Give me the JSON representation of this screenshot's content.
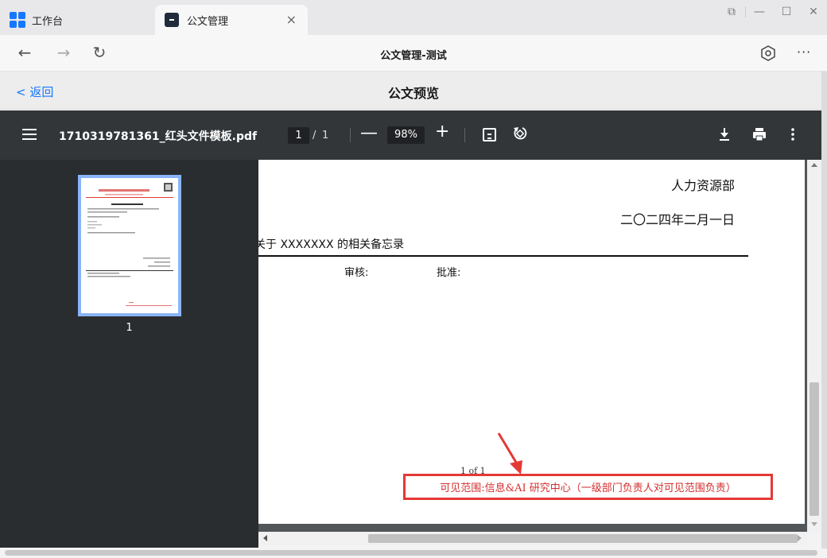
{
  "browser": {
    "tabs": [
      {
        "label": "工作台"
      },
      {
        "label": "公文管理"
      }
    ],
    "tab_close_glyph": "×",
    "window_controls": [
      "⧉",
      "—",
      "☐",
      "✕"
    ],
    "nav": {
      "back": "←",
      "forward": "→",
      "reload": "↻",
      "title": "公文管理-测试",
      "more": "···"
    }
  },
  "page_header": {
    "back_label": "< 返回",
    "title": "公文预览"
  },
  "pdf_toolbar": {
    "file_name": "1710319781361_红头文件模板.pdf",
    "current_page": "1",
    "page_separator": "/",
    "total_pages": "1",
    "zoom_minus": "—",
    "zoom": "98%",
    "zoom_plus": "+"
  },
  "sidebar": {
    "thumbnail_label": "1"
  },
  "document": {
    "department": "人力资源部",
    "date": "二〇二四年二月一日",
    "subject": "关于 XXXXXXX 的相关备忘录",
    "review_label": "审核:",
    "approve_label": "批准:",
    "page_footer": "1 of 1",
    "visible_scope_note": "可见范围:信息&AI 研究中心（一级部门负责人对可见范围负责）"
  },
  "colors": {
    "accent": "#1677ff",
    "toolbar_bg": "#323639",
    "sidebar_bg": "#2a2d30",
    "annotation_red": "#e53935",
    "thumb_border": "#8ab4f8"
  }
}
